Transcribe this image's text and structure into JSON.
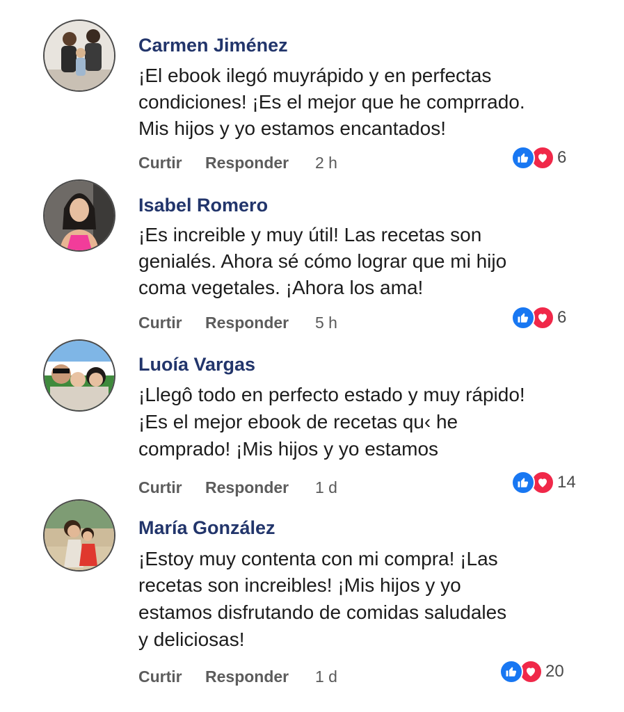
{
  "comments": [
    {
      "author": "Carmen Jiménez",
      "lines": [
        "¡El ebook ilegó muyrápido y en perfectas",
        "condiciones! ¡Es el mejor que he comprrado.",
        "Mis hijos y yo estamos encantados!"
      ],
      "like_label": "Curtir",
      "reply_label": "Responder",
      "time": "2 h",
      "reaction_count": "6"
    },
    {
      "author": "Isabel Romero",
      "lines": [
        "¡Es increible y muy útil! Las recetas son",
        "genialés. Ahora sé cómo lograr que mi  hijo",
        "coma vegetales. ¡Ahora los ama!"
      ],
      "like_label": "Curtir",
      "reply_label": "Responder",
      "time": "5 h",
      "reaction_count": "6"
    },
    {
      "author": "Luoía Vargas",
      "lines": [
        "¡Llegô todo en perfecto estado y muy rápido!",
        "¡Es el mejor ebook de recetas qu‹ he",
        "comprado! ¡Mis hijos y yo estamos"
      ],
      "like_label": "Curtir",
      "reply_label": "Responder",
      "time": "1 d",
      "reaction_count": "14"
    },
    {
      "author": "María González",
      "lines": [
        "¡Estoy muy contenta con mi compra! ¡Las",
        "recetas son increibles! ¡Mis hijos y yo",
        "estamos disfrutando de comidas saludales",
        "y deliciosas!"
      ],
      "like_label": "Curtir",
      "reply_label": "Responder",
      "time": "1 d",
      "reaction_count": "20"
    }
  ],
  "icons": {
    "like": "thumbs-up-icon",
    "love": "heart-icon"
  },
  "colors": {
    "author_name": "#22356b",
    "like_blue": "#1877f2",
    "love_red": "#f02849",
    "action_gray": "#5c5c5c"
  }
}
